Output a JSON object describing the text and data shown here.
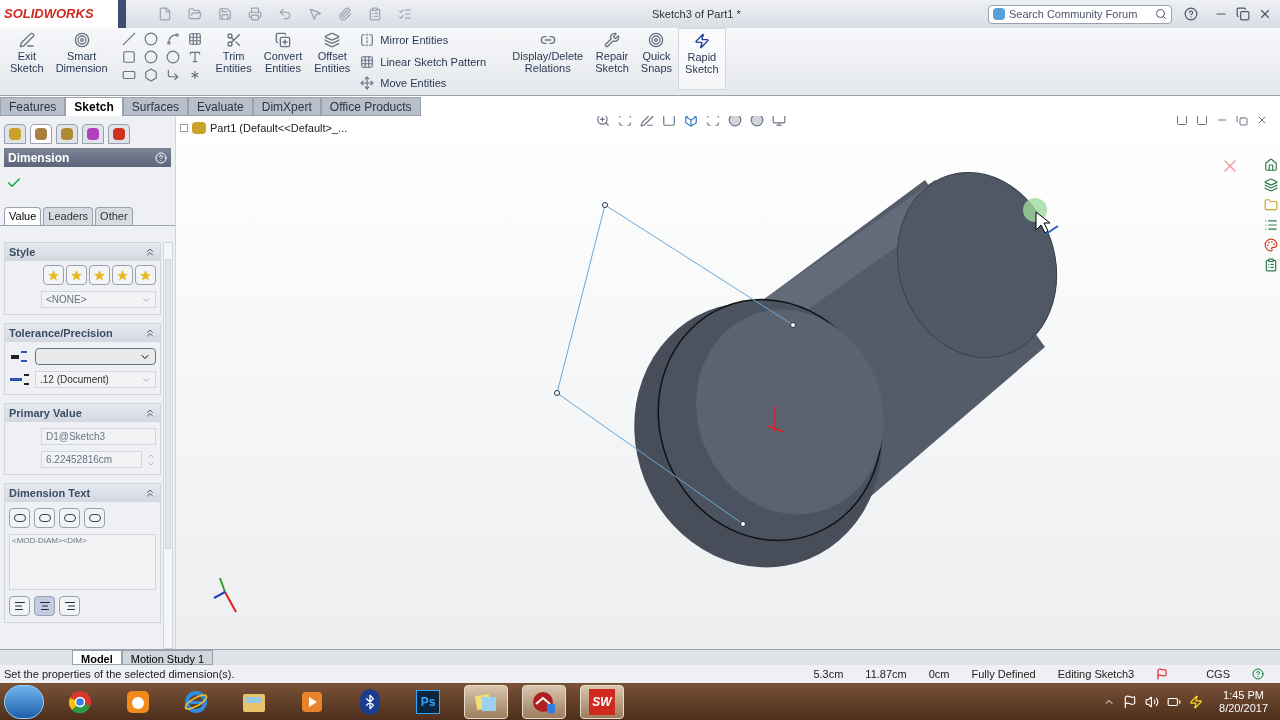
{
  "title_bar": {
    "logo": "SOLIDWORKS",
    "title": "Sketch3 of Part1 *",
    "search": {
      "placeholder": "Search Community Forum"
    }
  },
  "ribbon": {
    "tools": [
      {
        "kind": "large",
        "label": "Exit\nSketch"
      },
      {
        "kind": "large",
        "label": "Smart\nDimension"
      },
      {
        "kind": "grid"
      },
      {
        "kind": "large",
        "label": "Trim\nEntities"
      },
      {
        "kind": "large",
        "label": "Convert\nEntities"
      },
      {
        "kind": "large",
        "label": "Offset\nEntities"
      },
      {
        "kind": "list",
        "items": [
          {
            "label": "Mirror Entities"
          },
          {
            "label": "Linear Sketch Pattern"
          },
          {
            "label": "Move Entities"
          }
        ]
      },
      {
        "kind": "large",
        "label": "Display/Delete\nRelations"
      },
      {
        "kind": "large",
        "label": "Repair\nSketch"
      },
      {
        "kind": "large",
        "label": "Quick\nSnaps"
      },
      {
        "kind": "large",
        "label": "Rapid\nSketch"
      }
    ]
  },
  "command_tabs": [
    {
      "label": "Features",
      "selected": false
    },
    {
      "label": "Sketch",
      "selected": true
    },
    {
      "label": "Surfaces",
      "selected": false
    },
    {
      "label": "Evaluate",
      "selected": false
    },
    {
      "label": "DimXpert",
      "selected": false
    },
    {
      "label": "Office Products",
      "selected": false
    }
  ],
  "tree": {
    "label": "Part1 (Default<<Default>_..."
  },
  "property_manager": {
    "title": "Dimension",
    "tabs": [
      {
        "label": "Value",
        "selected": true
      },
      {
        "label": "Leaders",
        "selected": false
      },
      {
        "label": "Other",
        "selected": false
      }
    ],
    "style": {
      "title": "Style",
      "value": "<NONE>"
    },
    "tolerance": {
      "title": "Tolerance/Precision",
      "precision": ".12 (Document)"
    },
    "primary_value": {
      "title": "Primary Value",
      "name": "D1@Sketch3",
      "value": "6.22452816cm"
    },
    "dimension_text": {
      "title": "Dimension Text",
      "text": "<MOD-DIAM><DIM>",
      "alignment": [
        {
          "selected": false
        },
        {
          "selected": true
        },
        {
          "selected": false
        }
      ]
    }
  },
  "model_tabs": [
    {
      "label": "Model",
      "selected": true
    },
    {
      "label": "Motion Study 1",
      "selected": false
    }
  ],
  "status_bar": {
    "message": "Set the properties of the selected dimension(s).",
    "fields": [
      "5.3cm",
      "11.87cm",
      "0cm",
      "Fully Defined",
      "Editing Sketch3"
    ],
    "units": "CGS"
  },
  "taskbar": {
    "apps": [
      {
        "kind": "chrome",
        "running": false
      },
      {
        "kind": "uc",
        "running": false
      },
      {
        "kind": "ie",
        "running": false
      },
      {
        "kind": "explorer",
        "running": false
      },
      {
        "kind": "media",
        "running": false
      },
      {
        "kind": "bluetooth",
        "running": false
      },
      {
        "kind": "photoshop",
        "label": "Ps",
        "running": false
      },
      {
        "kind": "notes",
        "running": true
      },
      {
        "kind": "security",
        "running": true
      },
      {
        "kind": "solidworks",
        "label": "SW",
        "running": true
      }
    ],
    "time": "1:45 PM",
    "date": "8/20/2017"
  }
}
